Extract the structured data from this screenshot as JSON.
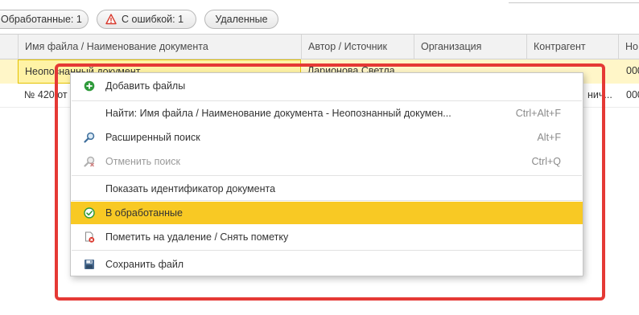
{
  "filters": {
    "processed_label": "Обработанные: 1",
    "error_label": "С ошибкой: 1",
    "deleted_label": "Удаленные"
  },
  "table": {
    "columns": [
      "Имя файла / Наименование документа",
      "Автор / Источник",
      "Организация",
      "Контрагент",
      "Но"
    ],
    "rows": [
      [
        "Неопознанный документ",
        "Ларионова Светла",
        "",
        "",
        "000"
      ],
      [
        "№ 420 от",
        "",
        "",
        "нич...",
        "000"
      ]
    ]
  },
  "context_menu": {
    "items": [
      {
        "label": "Добавить файлы",
        "shortcut": ""
      },
      {
        "label": "Найти: Имя файла / Наименование документа - Неопознанный докумен...",
        "shortcut": "Ctrl+Alt+F"
      },
      {
        "label": "Расширенный поиск",
        "shortcut": "Alt+F"
      },
      {
        "label": "Отменить поиск",
        "shortcut": "Ctrl+Q"
      },
      {
        "label": "Показать идентификатор документа",
        "shortcut": ""
      },
      {
        "label": "В обработанные",
        "shortcut": ""
      },
      {
        "label": "Пометить на удаление / Снять пометку",
        "shortcut": ""
      },
      {
        "label": "Сохранить файл",
        "shortcut": ""
      }
    ],
    "highlighted_item": "В обработанные",
    "icons": [
      "plus-circle-icon",
      "",
      "search-icon",
      "cancel-search-icon",
      "",
      "check-circle-icon",
      "delete-mark-icon",
      "floppy-disk-icon"
    ]
  },
  "colors": {
    "highlight": "#f8c924",
    "selected_row": "#fff6c8",
    "annotation_frame": "#e53935"
  }
}
